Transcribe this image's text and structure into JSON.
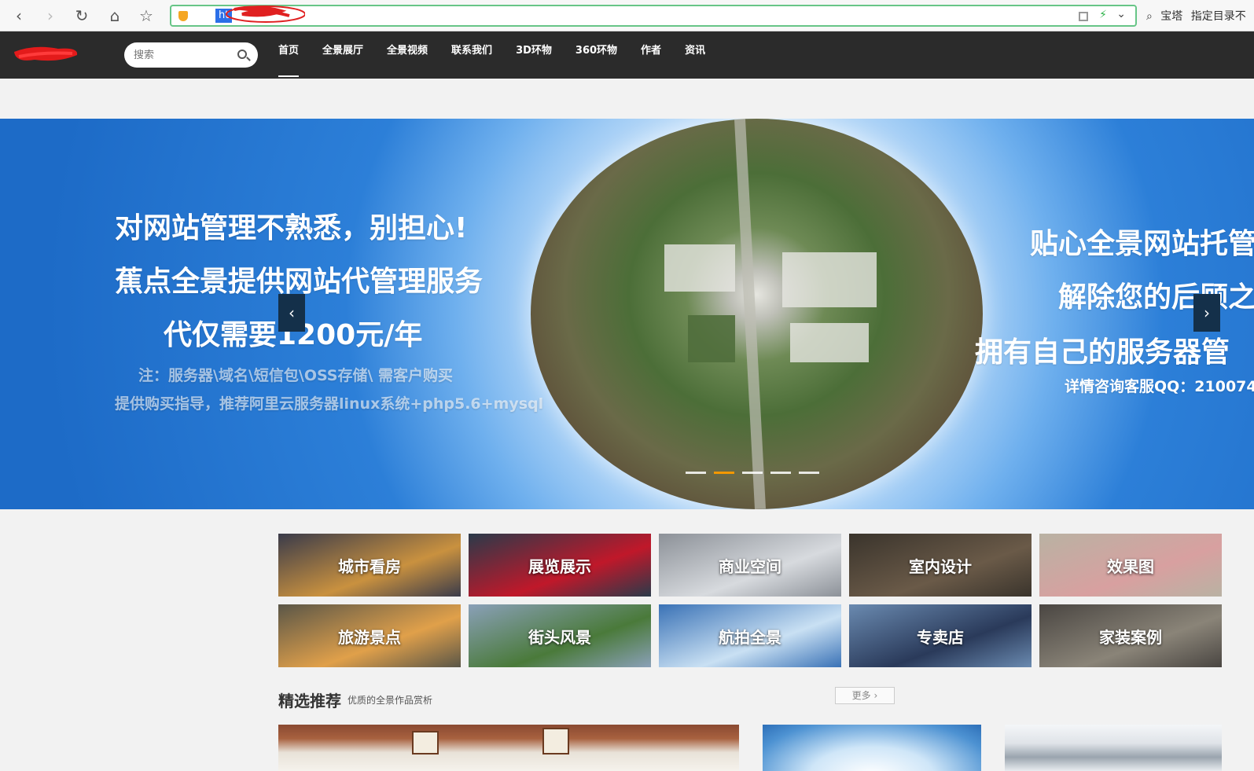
{
  "browser": {
    "back_icon": "‹",
    "forward_icon": "›",
    "reload_icon": "↻",
    "home_icon": "⌂",
    "star_icon": "☆",
    "url": "ht",
    "bolt_icon": "⚡",
    "chevron_icon": "⌄",
    "right_search_icon": "⌕",
    "right_labels": [
      "宝塔",
      "指定目录不"
    ]
  },
  "nav": {
    "search_placeholder": "搜索",
    "items": [
      {
        "label": "首页",
        "active": true
      },
      {
        "label": "全景展厅"
      },
      {
        "label": "全景视频"
      },
      {
        "label": "联系我们"
      },
      {
        "label": "3D环物"
      },
      {
        "label": "360环物"
      },
      {
        "label": "作者"
      },
      {
        "label": "资讯"
      }
    ]
  },
  "banner": {
    "left_lines": [
      "对网站管理不熟悉，别担心!",
      "蕉点全景提供网站代管理服务",
      "代仅需要1200元/年",
      "注：服务器\\域名\\短信包\\OSS存储\\ 需客户购买",
      "提供购买指导，推荐阿里云服务器linux系统+php5.6+mysql"
    ],
    "right_lines": [
      "贴心全景网站托管",
      "解除您的后顾之",
      "拥有自己的服务器管",
      "详情咨询客服QQ：210074"
    ],
    "prev_icon": "‹",
    "next_icon": "›",
    "active_dot": 1,
    "dot_count": 5
  },
  "categories": [
    {
      "label": "城市看房",
      "color": "#3a3b4a",
      "accent": "#c9913f"
    },
    {
      "label": "展览展示",
      "color": "#2a3a4a",
      "accent": "#c0182a"
    },
    {
      "label": "商业空间",
      "color": "#8c9198",
      "accent": "#d7dade"
    },
    {
      "label": "室内设计",
      "color": "#3a342c",
      "accent": "#6a5a48"
    },
    {
      "label": "效果图",
      "color": "#b9b2a3",
      "accent": "#d8a0a0"
    },
    {
      "label": "旅游景点",
      "color": "#5a5648",
      "accent": "#e0a04a"
    },
    {
      "label": "街头风景",
      "color": "#8aa0b8",
      "accent": "#4a7a3a"
    },
    {
      "label": "航拍全景",
      "color": "#3a72b6",
      "accent": "#c9e0f3"
    },
    {
      "label": "专卖店",
      "color": "#6a8ab0",
      "accent": "#2a3a5a"
    },
    {
      "label": "家装案例",
      "color": "#4a4642",
      "accent": "#8a8478"
    }
  ],
  "recommend": {
    "title": "精选推荐",
    "subtitle": "优质的全景作品赏析",
    "more_label": "更多",
    "more_icon": "›"
  }
}
